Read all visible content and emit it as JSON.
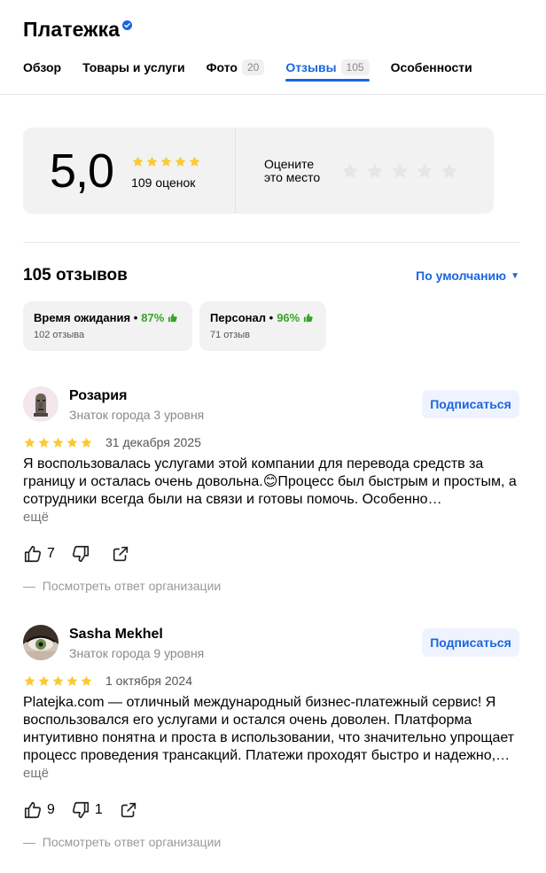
{
  "header": {
    "title": "Платежка",
    "tabs": [
      {
        "label": "Обзор",
        "count": ""
      },
      {
        "label": "Товары и услуги",
        "count": ""
      },
      {
        "label": "Фото",
        "count": "20"
      },
      {
        "label": "Отзывы",
        "count": "105"
      },
      {
        "label": "Особенности",
        "count": ""
      }
    ],
    "active_tab": "Отзывы"
  },
  "rating": {
    "score": "5,0",
    "stars": 5,
    "count_label": "109 оценок",
    "rate_label_line1": "Оцените",
    "rate_label_line2": "это место"
  },
  "reviews_section": {
    "title": "105 отзывов",
    "sort_label": "По умолчанию"
  },
  "aspects": [
    {
      "name": "Время ожидания",
      "percent": "87%",
      "count": "102 отзыва"
    },
    {
      "name": "Персонал",
      "percent": "96%",
      "count": "71 отзыв"
    }
  ],
  "reviews": [
    {
      "name": "Розария",
      "level": "Знаток города 3 уровня",
      "stars": 5,
      "date": "31 декабря 2025",
      "text": "Я воспользовалась услугами этой компании для перевода средств за границу и осталась очень довольна.😊Процесс был быстрым и простым, а сотрудники всегда были на связи и готовы помочь. Особенно…",
      "more": "ещё",
      "likes": "7",
      "dislikes": "",
      "subscribe": "Подписаться",
      "org_answer": "Посмотреть ответ организации"
    },
    {
      "name": "Sasha Mekhel",
      "level": "Знаток города 9 уровня",
      "stars": 5,
      "date": "1 октября 2024",
      "text": "Platejka.com — отличный международный бизнес-платежный сервис! Я воспользовался его услугами и остался очень доволен. Платформа интуитивно понятна и проста в использовании, что значительно упрощает процесс проведения трансакций. Платежи проходят быстро и надежно,…",
      "more": "ещё",
      "likes": "9",
      "dislikes": "1",
      "subscribe": "Подписаться",
      "org_answer": "Посмотреть ответ организации"
    }
  ],
  "colors": {
    "accent": "#1a66e0",
    "star": "#fcc934",
    "positive": "#39a32b",
    "muted": "#888888"
  }
}
